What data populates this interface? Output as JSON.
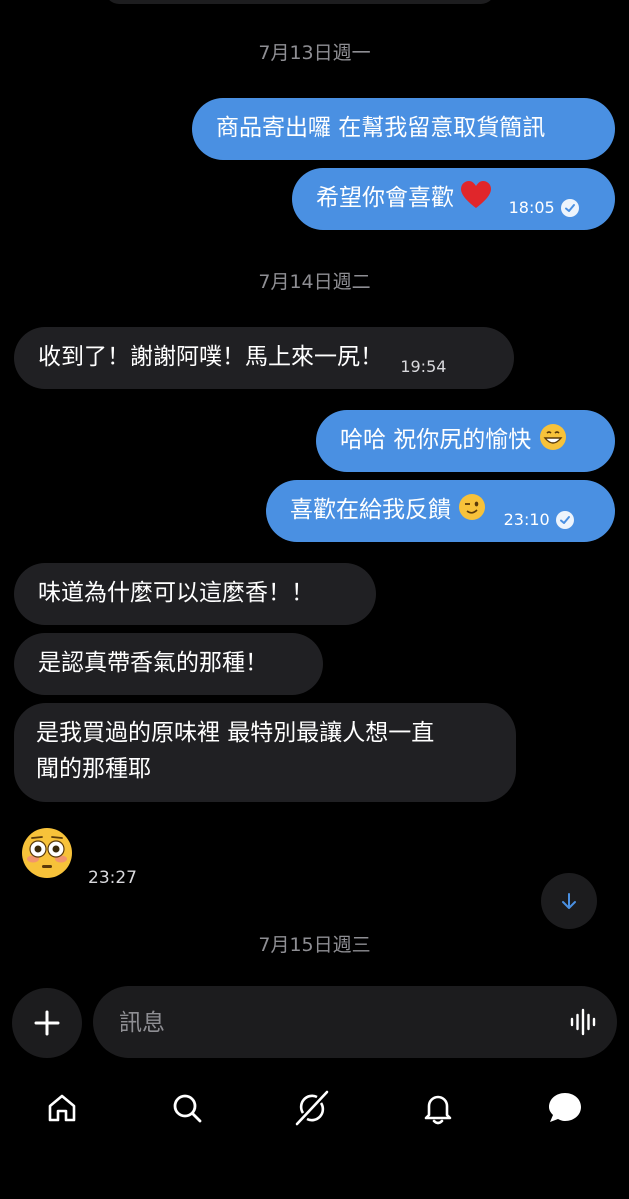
{
  "dates": {
    "d1": "7月13日週一",
    "d2": "7月14日週二",
    "d3": "7月15日週三"
  },
  "messages": [
    {
      "direction": "out",
      "text": "商品寄出囉 在幫我留意取貨簡訊",
      "time": ""
    },
    {
      "direction": "out",
      "text": "希望你會喜歡",
      "emoji": "red-heart",
      "time": "18:05",
      "read": true
    },
    {
      "direction": "in",
      "text": "收到了！謝謝阿噗！馬上來一尻！",
      "time": "19:54"
    },
    {
      "direction": "out",
      "text": "哈哈 祝你尻的愉快",
      "emoji": "grinning-face",
      "time": ""
    },
    {
      "direction": "out",
      "text": "喜歡在給我反饋",
      "emoji": "winking-face",
      "time": "23:10",
      "read": true
    },
    {
      "direction": "in",
      "text": "味道為什麼可以這麼香！！",
      "time": ""
    },
    {
      "direction": "in",
      "text": "是認真帶香氣的那種！",
      "time": ""
    },
    {
      "direction": "in",
      "text": "是我買過的原味裡 最特別最讓人想一直",
      "text2": "聞的那種耶",
      "time": ""
    },
    {
      "direction": "in",
      "emoji": "flushed-face",
      "time": "23:27"
    }
  ],
  "composer": {
    "placeholder": "訊息"
  },
  "nav": [
    "home-icon",
    "search-icon",
    "grok-icon",
    "bell-icon",
    "messages-icon"
  ],
  "colors": {
    "outgoing": "#4a90e2",
    "incoming": "#202023",
    "background": "#000000"
  }
}
